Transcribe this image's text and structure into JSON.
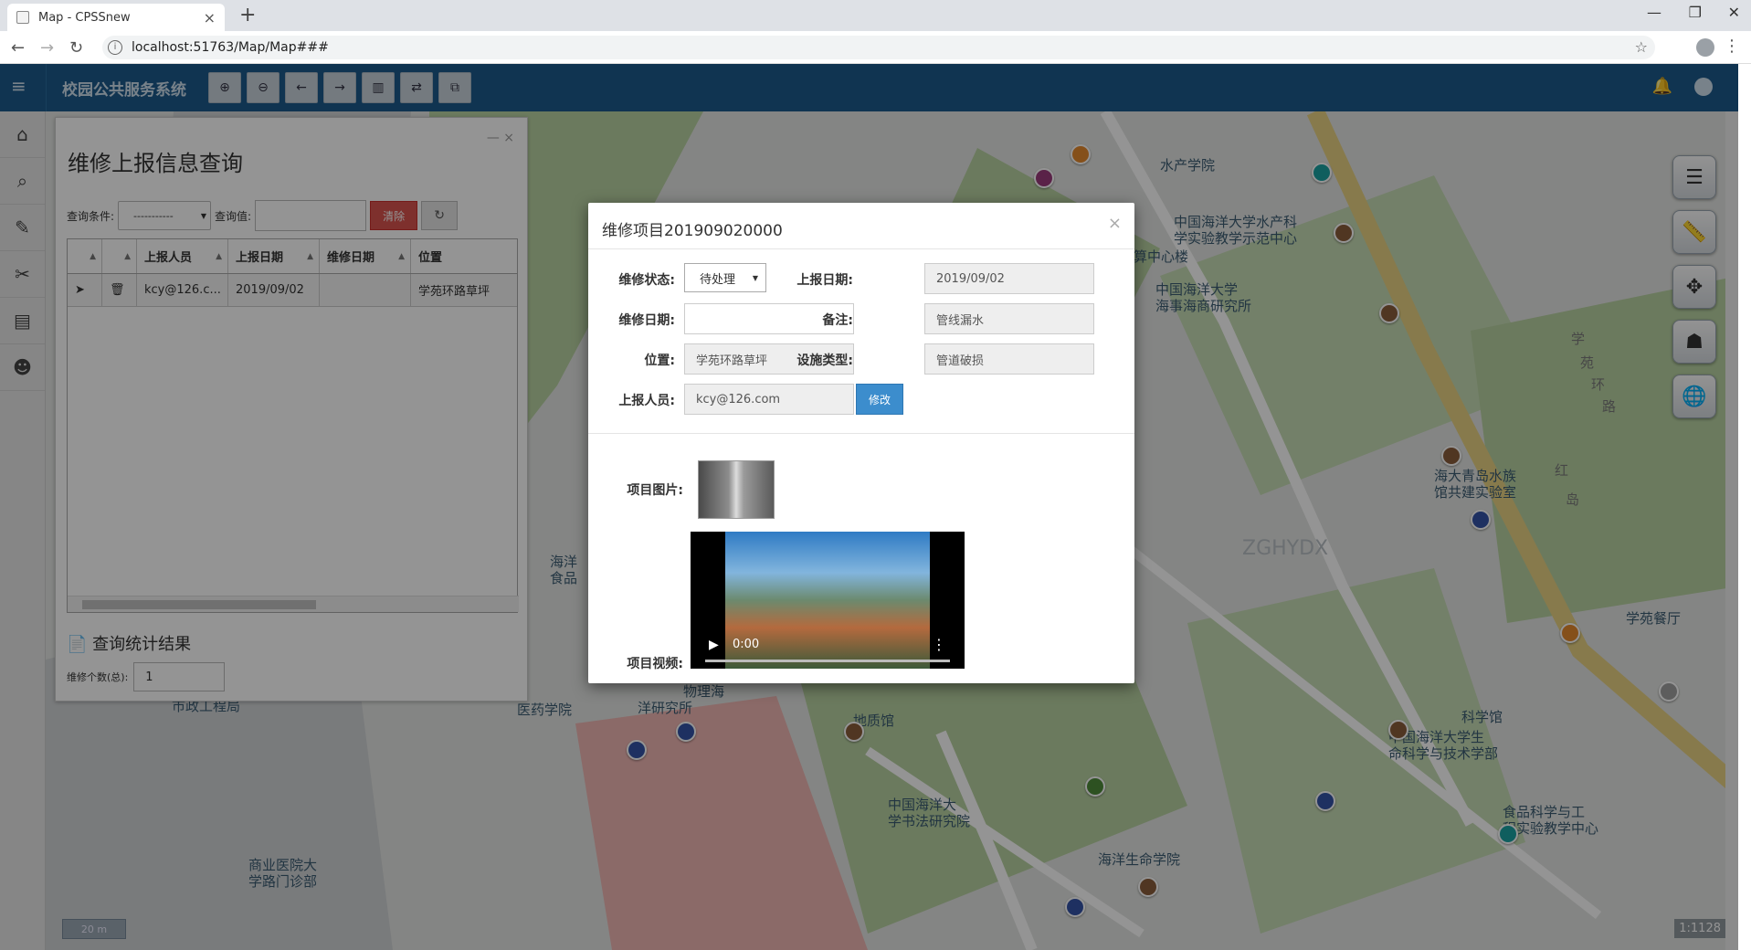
{
  "browser": {
    "tab_title": "Map - CPSSnew",
    "url": "localhost:51763/Map/Map###"
  },
  "app": {
    "title": "校园公共服务系统"
  },
  "map": {
    "labels": [
      "水产学院",
      "中国海洋大学水产科",
      "学实验教学示范中心",
      "计算中心楼",
      "中国海洋大学",
      "海事海商研究所",
      "海大青岛水族",
      "馆共建实验室",
      "学苑餐厅",
      "科学馆",
      "中国海洋大学生",
      "命科学与技术学部",
      "食品科学与工",
      "程实验教学中心",
      "海洋生命学院",
      "中国海洋大",
      "学书法研究院",
      "地质馆",
      "医药学院",
      "物理海",
      "洋研究所",
      "市政工程局",
      "商业医院大",
      "学路门诊部",
      "海洋",
      "食品"
    ],
    "road_labels": [
      "学",
      "苑",
      "环",
      "路",
      "红",
      "岛",
      "ZGHYDX"
    ],
    "scale_label": "20 m",
    "ratio_label": "1:1128"
  },
  "query_panel": {
    "title": "维修上报信息查询",
    "condition_label": "查询条件:",
    "condition_value": "-----------",
    "value_label": "查询值:",
    "clear_button": "清除",
    "columns": [
      "上报人员",
      "上报日期",
      "维修日期",
      "位置"
    ],
    "rows": [
      {
        "reporter": "kcy@126.c...",
        "report_date": "2019/09/02",
        "repair_date": "",
        "location": "学苑环路草坪"
      }
    ],
    "stats_title": "查询统计结果",
    "count_label": "维修个数(总):",
    "count_value": "1"
  },
  "modal": {
    "title": "维修项目201909020000",
    "status_label": "维修状态:",
    "status_value": "待处理",
    "report_date_label": "上报日期:",
    "report_date_value": "2019/09/02",
    "repair_date_label": "维修日期:",
    "repair_date_value": "",
    "remark_label": "备注:",
    "remark_value": "管线漏水",
    "location_label": "位置:",
    "location_value": "学苑环路草坪",
    "facility_type_label": "设施类型:",
    "facility_type_value": "管道破损",
    "reporter_label": "上报人员:",
    "reporter_value": "kcy@126.com",
    "edit_button": "修改",
    "image_label": "项目图片:",
    "video_label": "项目视频:",
    "video_time": "0:00"
  }
}
